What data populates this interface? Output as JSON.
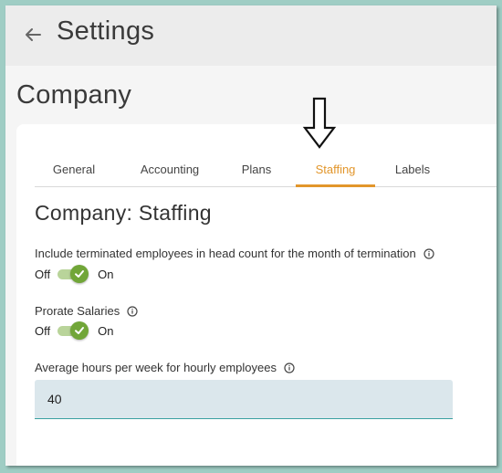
{
  "header": {
    "title": "Settings",
    "back_icon": "arrow-left-icon"
  },
  "section_title": "Company",
  "tabs": [
    {
      "label": "General",
      "active": false
    },
    {
      "label": "Accounting",
      "active": false
    },
    {
      "label": "Plans",
      "active": false
    },
    {
      "label": "Staffing",
      "active": true
    },
    {
      "label": "Labels",
      "active": false
    }
  ],
  "content": {
    "heading": "Company: Staffing",
    "settings": [
      {
        "label": "Include terminated employees in head count for the month of termination",
        "off_label": "Off",
        "on_label": "On",
        "state": "on"
      },
      {
        "label": "Prorate Salaries",
        "off_label": "Off",
        "on_label": "On",
        "state": "on"
      }
    ],
    "hours_field": {
      "label": "Average hours per week for hourly employees",
      "value": "40"
    }
  },
  "colors": {
    "accent": "#e2962b",
    "toggle_on": "#71a638",
    "field_bg": "#dbe7ec",
    "border_teal": "#9fcdc4"
  }
}
